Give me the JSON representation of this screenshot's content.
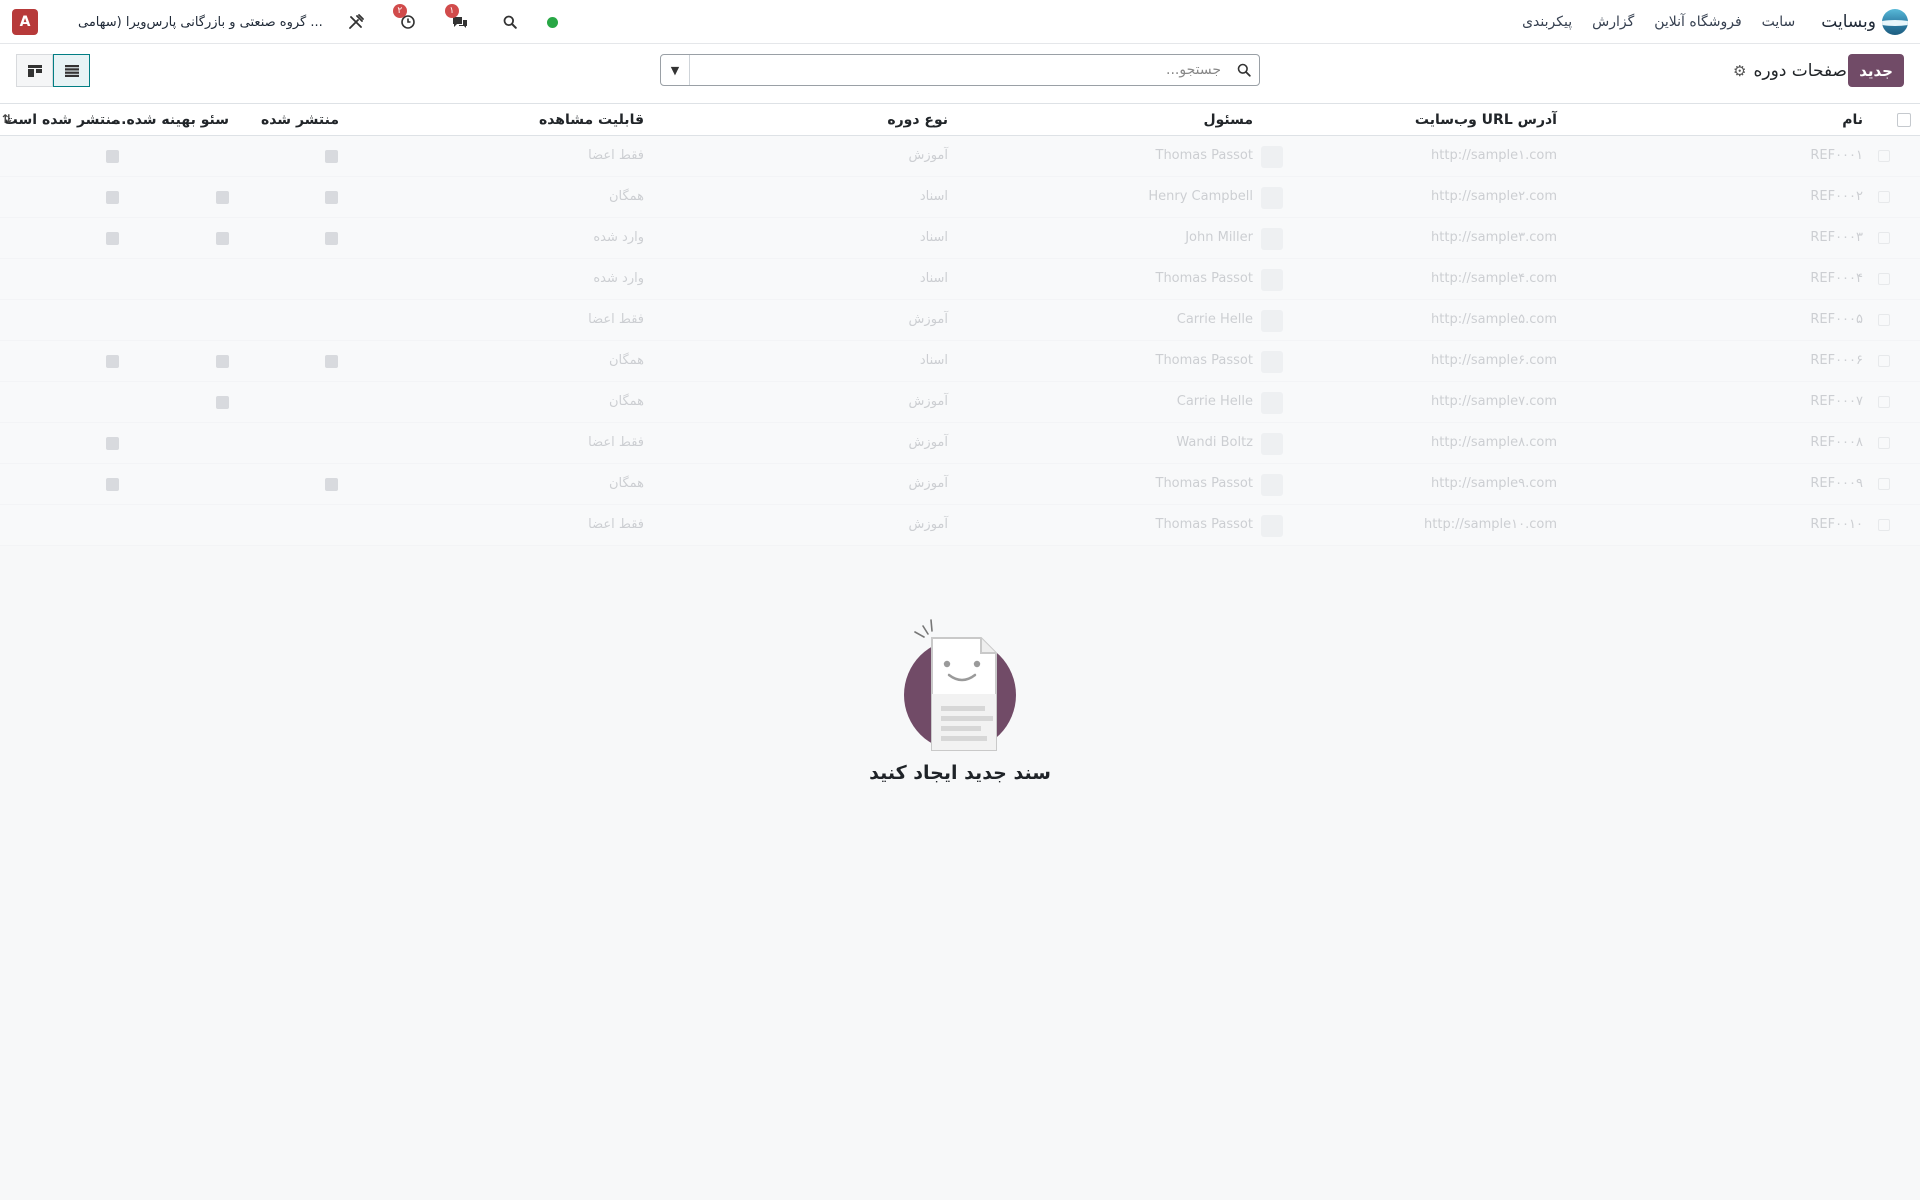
{
  "navbar": {
    "brand": "وبسایت",
    "menu": [
      "سایت",
      "فروشگاه آنلاین",
      "گزارش",
      "پیکربندی"
    ],
    "company": "گروه صنعتی و بازرگانی پارس‌ویرا (سهامی ...",
    "user_initial": "A",
    "activity_badge": "۲",
    "messages_badge": "۱",
    "status_color": "#28a745",
    "icons": [
      "debug-tools-icon",
      "clock-icon",
      "chat-icon",
      "search-icon"
    ]
  },
  "control": {
    "new_button": "جدید",
    "page_title": "صفحات دوره",
    "search_placeholder": "جستجو...",
    "views": [
      "kanban-view",
      "list-view"
    ],
    "active_view": "list-view",
    "brand_color": "#714b67"
  },
  "columns": {
    "name": "نام",
    "url": "آدرس URL وب‌سایت",
    "responsible": "مسئول",
    "type": "نوع دوره",
    "visibility": "قابلیت مشاهده",
    "published": "منتشر شده",
    "seo": "سئو بهینه شده...",
    "is_published": "منتشر شده است"
  },
  "rows": [
    {
      "name": "REF۰۰۰۱",
      "url": "http://sample۱.com",
      "responsible": "Thomas Passot",
      "type": "آموزش",
      "visibility": "فقط اعضا",
      "published": true,
      "seo": false,
      "is_published": true
    },
    {
      "name": "REF۰۰۰۲",
      "url": "http://sample۲.com",
      "responsible": "Henry Campbell",
      "type": "اسناد",
      "visibility": "همگان",
      "published": true,
      "seo": true,
      "is_published": true
    },
    {
      "name": "REF۰۰۰۳",
      "url": "http://sample۳.com",
      "responsible": "John Miller",
      "type": "اسناد",
      "visibility": "وارد شده",
      "published": true,
      "seo": true,
      "is_published": true
    },
    {
      "name": "REF۰۰۰۴",
      "url": "http://sample۴.com",
      "responsible": "Thomas Passot",
      "type": "اسناد",
      "visibility": "وارد شده",
      "published": false,
      "seo": false,
      "is_published": false
    },
    {
      "name": "REF۰۰۰۵",
      "url": "http://sample۵.com",
      "responsible": "Carrie Helle",
      "type": "آموزش",
      "visibility": "فقط اعضا",
      "published": false,
      "seo": false,
      "is_published": false
    },
    {
      "name": "REF۰۰۰۶",
      "url": "http://sample۶.com",
      "responsible": "Thomas Passot",
      "type": "اسناد",
      "visibility": "همگان",
      "published": true,
      "seo": true,
      "is_published": true
    },
    {
      "name": "REF۰۰۰۷",
      "url": "http://sample۷.com",
      "responsible": "Carrie Helle",
      "type": "آموزش",
      "visibility": "همگان",
      "published": false,
      "seo": true,
      "is_published": false
    },
    {
      "name": "REF۰۰۰۸",
      "url": "http://sample۸.com",
      "responsible": "Wandi Boltz",
      "type": "آموزش",
      "visibility": "فقط اعضا",
      "published": false,
      "seo": false,
      "is_published": true
    },
    {
      "name": "REF۰۰۰۹",
      "url": "http://sample۹.com",
      "responsible": "Thomas Passot",
      "type": "آموزش",
      "visibility": "همگان",
      "published": true,
      "seo": false,
      "is_published": true
    },
    {
      "name": "REF۰۰۱۰",
      "url": "http://sample۱۰.com",
      "responsible": "Thomas Passot",
      "type": "آموزش",
      "visibility": "فقط اعضا",
      "published": false,
      "seo": false,
      "is_published": false
    }
  ],
  "helper": {
    "title": "سند جدید ایجاد کنید",
    "illustration_color": "#714b67"
  }
}
